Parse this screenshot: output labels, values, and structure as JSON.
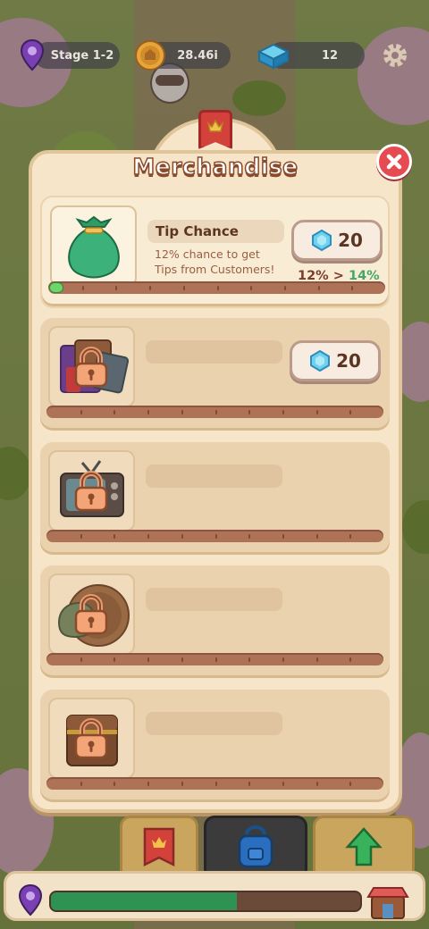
{
  "hud": {
    "stage_label": "Stage 1-2",
    "coins_value": "28.46i",
    "gems_value": "12",
    "settings_icon": "gear-icon"
  },
  "dialog": {
    "title": "Merchandise",
    "close_icon": "close-icon"
  },
  "upgrades": [
    {
      "name": "Tip Chance",
      "description_line1": "12% chance to get",
      "description_line2": "Tips from Customers!",
      "cost": "20",
      "current_value": "12%",
      "arrow": ">",
      "next_value": "14%",
      "locked": false,
      "progress": 0.04,
      "icon": "money-bag-icon"
    },
    {
      "locked": true,
      "cost": "20",
      "icon": "gift-box-icon",
      "progress": 0
    },
    {
      "locked": true,
      "icon": "television-icon",
      "progress": 0
    },
    {
      "locked": true,
      "icon": "coin-pouch-icon",
      "progress": 0
    },
    {
      "locked": true,
      "icon": "treasure-chest-icon",
      "progress": 0
    }
  ],
  "bottom_tabs": [
    "banner-tab-icon",
    "backpack-tab-icon",
    "upgrade-arrow-icon"
  ],
  "xp_bar": {
    "progress": 0.6
  },
  "colors": {
    "accent_red": "#e74b52",
    "progress_green": "#6fd46b",
    "next_value_green": "#46a76b",
    "panel_bg": "#f6e5c9"
  }
}
